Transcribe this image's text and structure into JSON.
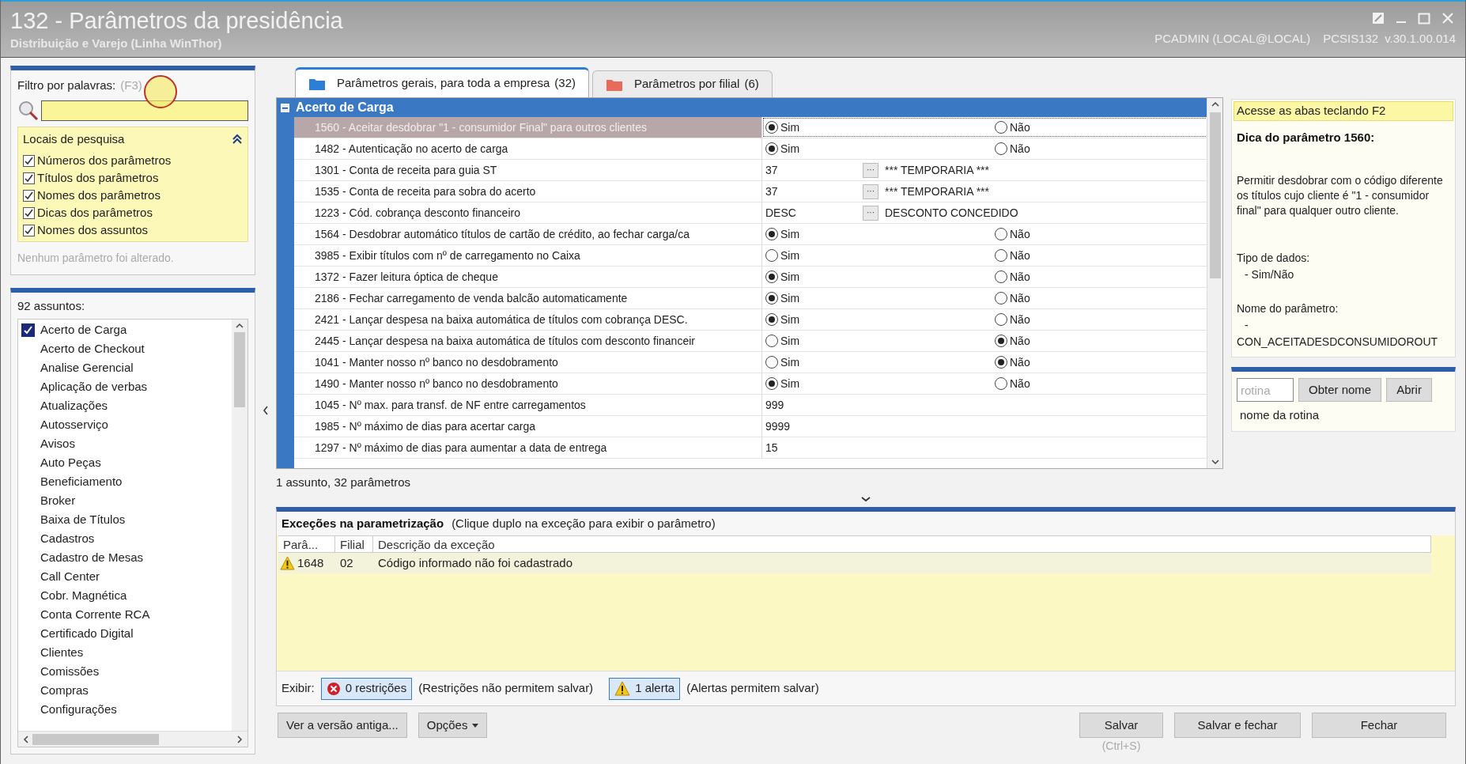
{
  "window": {
    "title": "132 - Parâmetros da presidência",
    "subtitle": "Distribuição e Varejo (Linha WinThor)",
    "user": "PCADMIN (LOCAL@LOCAL)",
    "routine": "PCSIS132",
    "version": "v.30.1.00.014"
  },
  "filter": {
    "label": "Filtro por palavras:",
    "shortcut": "(F3)",
    "search_places": {
      "title": "Locais de pesquisa",
      "expanded": true,
      "options": [
        {
          "label": "Números dos parâmetros",
          "checked": true
        },
        {
          "label": "Títulos dos parâmetros",
          "checked": true
        },
        {
          "label": "Nomes dos parâmetros",
          "checked": true
        },
        {
          "label": "Dicas dos parâmetros",
          "checked": true
        },
        {
          "label": "Nomes dos assuntos",
          "checked": true
        }
      ]
    },
    "status": "Nenhum parâmetro foi alterado."
  },
  "subjects": {
    "count_label": "92 assuntos:",
    "items": [
      {
        "label": "Acerto de Carga",
        "checked": true
      },
      {
        "label": "Acerto de Checkout",
        "checked": false
      },
      {
        "label": "Analise Gerencial",
        "checked": false
      },
      {
        "label": "Aplicação de verbas",
        "checked": false
      },
      {
        "label": "Atualizações",
        "checked": false
      },
      {
        "label": "Autosserviço",
        "checked": false
      },
      {
        "label": "Avisos",
        "checked": false
      },
      {
        "label": "Auto Peças",
        "checked": false
      },
      {
        "label": "Beneficiamento",
        "checked": false
      },
      {
        "label": "Broker",
        "checked": false
      },
      {
        "label": "Baixa de Títulos",
        "checked": false
      },
      {
        "label": "Cadastros",
        "checked": false
      },
      {
        "label": "Cadastro de Mesas",
        "checked": false
      },
      {
        "label": "Call Center",
        "checked": false
      },
      {
        "label": "Cobr. Magnética",
        "checked": false
      },
      {
        "label": "Conta Corrente RCA",
        "checked": false
      },
      {
        "label": "Certificado Digital",
        "checked": false
      },
      {
        "label": "Clientes",
        "checked": false
      },
      {
        "label": "Comissões",
        "checked": false
      },
      {
        "label": "Compras",
        "checked": false
      },
      {
        "label": "Configurações",
        "checked": false
      }
    ]
  },
  "tabs": [
    {
      "label": "Parâmetros gerais, para toda a empresa",
      "count": "(32)",
      "selected": true
    },
    {
      "label": "Parâmetros por filial",
      "count": "(6)",
      "selected": false
    }
  ],
  "group": {
    "title": "Acerto de Carga",
    "expanded": true
  },
  "parameters": [
    {
      "kind": "yesno",
      "name": "1560 - Aceitar desdobrar \"1 - consumidor Final\" para outros clientes",
      "selected": true,
      "options": [
        {
          "label": "Sim",
          "selected": true
        },
        {
          "label": "Não",
          "selected": false
        }
      ]
    },
    {
      "kind": "yesno",
      "name": "1482 - Autenticação no acerto de carga",
      "selected": false,
      "options": [
        {
          "label": "Sim",
          "selected": true
        },
        {
          "label": "Não",
          "selected": false
        }
      ]
    },
    {
      "kind": "lookup",
      "name": "1301 - Conta de receita para guia ST",
      "selected": false,
      "value": "37",
      "button": "···",
      "description": "*** TEMPORARIA ***"
    },
    {
      "kind": "lookup",
      "name": "1535 - Conta de receita para sobra do acerto",
      "selected": false,
      "value": "37",
      "button": "···",
      "description": "*** TEMPORARIA ***"
    },
    {
      "kind": "lookup",
      "name": "1223 - Cód. cobrança desconto financeiro",
      "selected": false,
      "value": "DESC",
      "button": "···",
      "description": "DESCONTO CONCEDIDO"
    },
    {
      "kind": "yesno",
      "name": "1564 - Desdobrar automático títulos de cartão de crédito, ao fechar carga/ca",
      "selected": false,
      "options": [
        {
          "label": "Sim",
          "selected": true
        },
        {
          "label": "Não",
          "selected": false
        }
      ]
    },
    {
      "kind": "yesno",
      "name": "3985 - Exibir títulos com nº de carregamento no Caixa",
      "selected": false,
      "options": [
        {
          "label": "Sim",
          "selected": false
        },
        {
          "label": "Não",
          "selected": false
        }
      ]
    },
    {
      "kind": "yesno",
      "name": "1372 - Fazer leitura óptica de cheque",
      "selected": false,
      "options": [
        {
          "label": "Sim",
          "selected": true
        },
        {
          "label": "Não",
          "selected": false
        }
      ]
    },
    {
      "kind": "yesno",
      "name": "2186 - Fechar carregamento de venda balcão automaticamente",
      "selected": false,
      "options": [
        {
          "label": "Sim",
          "selected": true
        },
        {
          "label": "Não",
          "selected": false
        }
      ]
    },
    {
      "kind": "yesno",
      "name": "2421 - Lançar despesa na baixa automática de títulos com cobrança DESC.",
      "selected": false,
      "options": [
        {
          "label": "Sim",
          "selected": true
        },
        {
          "label": "Não",
          "selected": false
        }
      ]
    },
    {
      "kind": "yesno",
      "name": "2445 - Lançar despesa na baixa automática de títulos com desconto financeir",
      "selected": false,
      "options": [
        {
          "label": "Sim",
          "selected": false
        },
        {
          "label": "Não",
          "selected": true
        }
      ]
    },
    {
      "kind": "yesno",
      "name": "1041 - Manter nosso nº banco no desdobramento",
      "selected": false,
      "options": [
        {
          "label": "Sim",
          "selected": false
        },
        {
          "label": "Não",
          "selected": true
        }
      ]
    },
    {
      "kind": "yesno",
      "name": "1490 - Manter nosso nº banco no desdobramento",
      "selected": false,
      "options": [
        {
          "label": "Sim",
          "selected": true
        },
        {
          "label": "Não",
          "selected": false
        }
      ]
    },
    {
      "kind": "value",
      "name": "1045 - Nº max. para transf. de NF entre carregamentos",
      "selected": false,
      "value": "999"
    },
    {
      "kind": "value",
      "name": "1985 - Nº máximo de dias para acertar carga",
      "selected": false,
      "value": "9999"
    },
    {
      "kind": "value",
      "name": "1297 - Nº máximo de dias para aumentar a data de entrega",
      "selected": false,
      "value": "15"
    }
  ],
  "grid_status": "1 assunto, 32 parâmetros",
  "hint": {
    "banner": "Acesse as abas teclando F2",
    "title": "Dica do parâmetro 1560:",
    "description": "Permitir desdobrar com o código diferente os títulos cujo cliente é \"1 - consumidor final\" para qualquer outro cliente.",
    "type_label": "Tipo de dados:",
    "type_value": "- Sim/Não",
    "name_label": "Nome do parâmetro:",
    "name_value": "-",
    "name_code": "CON_ACEITADESDCONSUMIDOROUT"
  },
  "routine": {
    "placeholder": "rotina",
    "buttons": [
      "Obter nome",
      "Abrir"
    ],
    "result": "nome da rotina"
  },
  "exceptions": {
    "title": "Exceções na parametrização",
    "hint": "(Clique duplo na exceção para exibir o parâmetro)",
    "columns": [
      "Parâ...",
      "Filial",
      "Descrição da exceção"
    ],
    "rows": [
      {
        "kind": "alert",
        "parameter": "1648",
        "branch": "02",
        "description": "Código informado não foi cadastrado"
      }
    ],
    "show_label": "Exibir:",
    "filters": [
      {
        "kind": "restriction",
        "label": "0 restrições",
        "note": "(Restrições não permitem salvar)"
      },
      {
        "kind": "alert",
        "label": "1 alerta",
        "note": "(Alertas permitem salvar)"
      }
    ]
  },
  "actions": {
    "left": [
      {
        "kind": "plain",
        "label": "Ver a versão antiga..."
      },
      {
        "kind": "menu",
        "label": "Opções"
      }
    ],
    "right": [
      {
        "label": "Salvar",
        "shortcut": "(Ctrl+S)"
      },
      {
        "label": "Salvar e fechar"
      },
      {
        "label": "Fechar"
      }
    ]
  }
}
